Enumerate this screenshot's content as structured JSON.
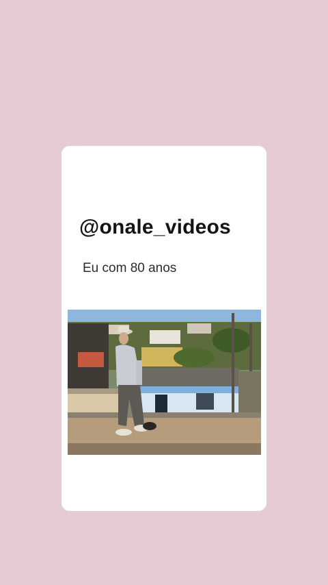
{
  "post": {
    "handle": "@onale_videos",
    "caption": "Eu com 80 anos"
  },
  "video": {
    "icon": "video-thumbnail"
  },
  "colors": {
    "background": "#e6cbd3",
    "card": "#ffffff",
    "text": "#141414"
  }
}
